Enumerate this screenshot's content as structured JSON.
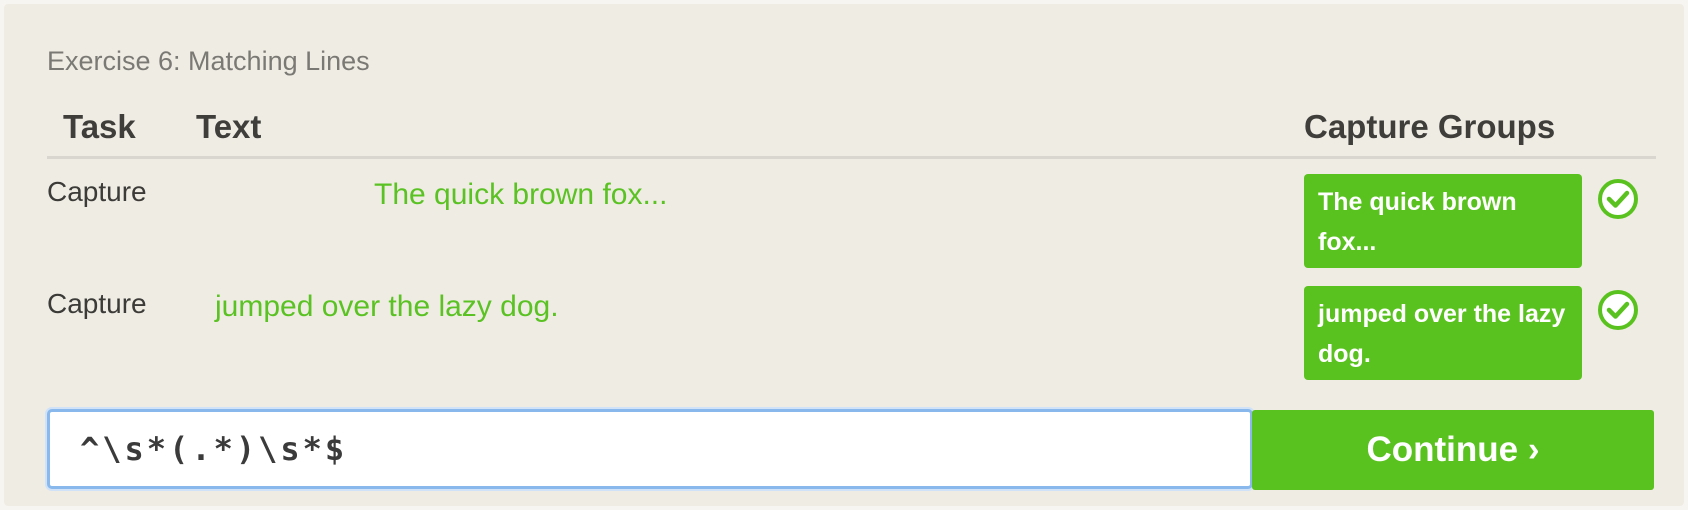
{
  "exercise": {
    "title": "Exercise 6: Matching Lines"
  },
  "table": {
    "headers": {
      "task": "Task",
      "text": "Text",
      "capture_groups": "Capture Groups"
    },
    "rows": [
      {
        "task": "Capture",
        "text": "The quick brown fox...",
        "capture_group": "The quick brown fox...",
        "status": "matched",
        "status_icon": "check-circle-icon"
      },
      {
        "task": "Capture",
        "text": "jumped over the lazy dog.",
        "capture_group": "jumped over the lazy dog.",
        "status": "matched",
        "status_icon": "check-circle-icon"
      }
    ]
  },
  "regex_input": {
    "value": "^\\s*(.*)\\s*$"
  },
  "continue_button": {
    "label": "Continue ›"
  },
  "colors": {
    "accent_green": "#5ac21e",
    "match_text_green": "#5bc224",
    "panel_background": "#efece4",
    "input_focus_border": "#88b8ec"
  }
}
